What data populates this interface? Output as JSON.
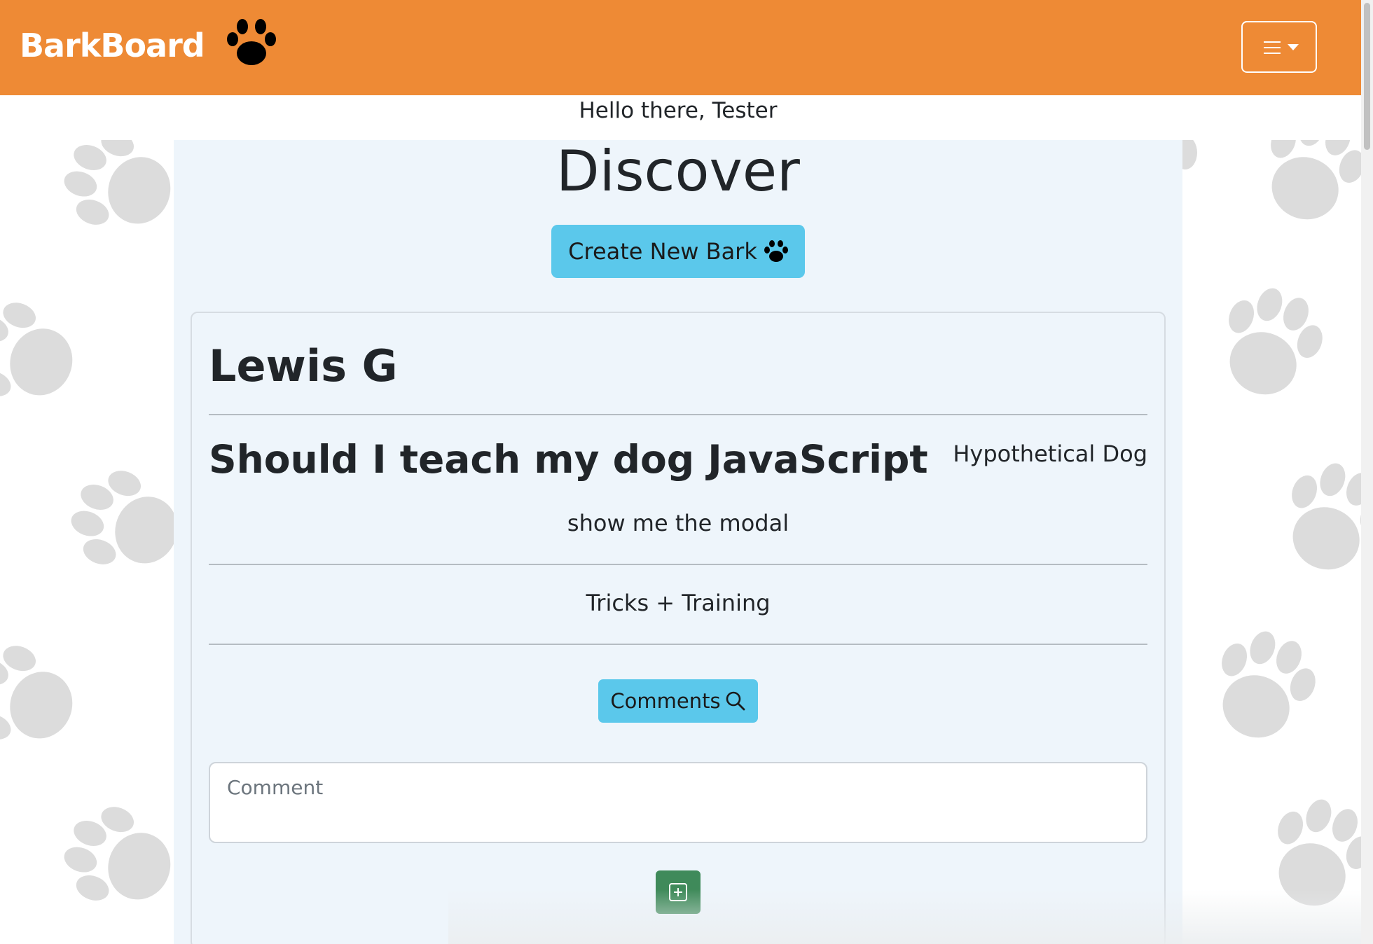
{
  "navbar": {
    "brand": "BarkBoard",
    "brand_icon": "paw-icon",
    "menu_icon": "hamburger-icon",
    "color": "#ee8a35"
  },
  "greeting": "Hello there, Tester",
  "page": {
    "title": "Discover",
    "create_button": "Create New Bark",
    "panel_color": "#eef5fb"
  },
  "post": {
    "author": "Lewis G",
    "title": "Should I teach my dog JavaScript",
    "dog": "Hypothetical Dog",
    "body": "show me the modal",
    "category": "Tricks + Training",
    "comments_button": "Comments",
    "comment_placeholder": "Comment",
    "add_button_icon": "plus-square-icon"
  },
  "colors": {
    "accent": "#5bc8eb",
    "add": "#3f8a5a",
    "paw_bg": "#d9d9d9"
  }
}
